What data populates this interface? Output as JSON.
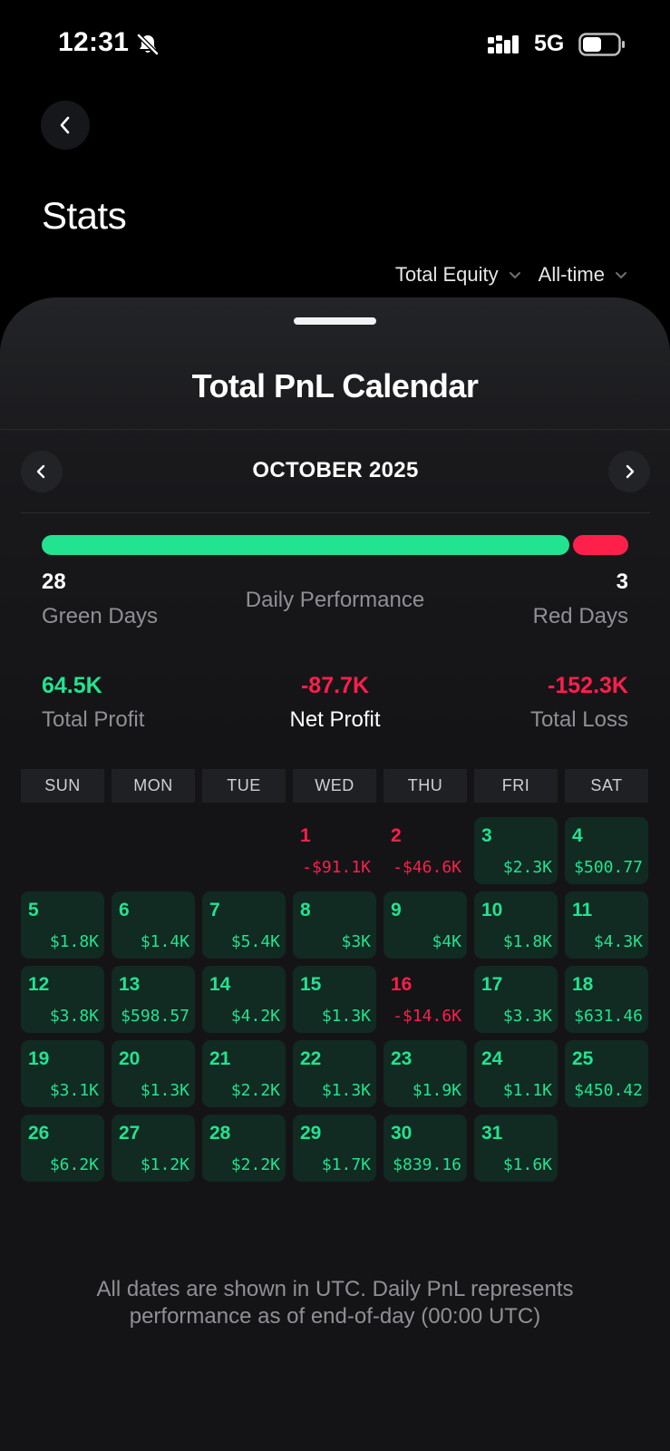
{
  "status_bar": {
    "time": "12:31",
    "network": "5G"
  },
  "page": {
    "title": "Stats"
  },
  "filters": {
    "equity": "Total Equity",
    "range": "All-time"
  },
  "sheet": {
    "title": "Total PnL Calendar"
  },
  "month": {
    "label": "OCTOBER 2025"
  },
  "performance": {
    "label": "Daily Performance",
    "green_count": "28",
    "green_label": "Green Days",
    "red_count": "3",
    "red_label": "Red Days",
    "green_fraction": 0.9032
  },
  "summary": {
    "total_profit_value": "64.5K",
    "total_profit_label": "Total Profit",
    "net_profit_value": "-87.7K",
    "net_profit_label": "Net Profit",
    "total_loss_value": "-152.3K",
    "total_loss_label": "Total Loss"
  },
  "weekdays": [
    "SUN",
    "MON",
    "TUE",
    "WED",
    "THU",
    "FRI",
    "SAT"
  ],
  "calendar": {
    "days": [
      {
        "day": "1",
        "value": "-$91.1K",
        "status": "neg"
      },
      {
        "day": "2",
        "value": "-$46.6K",
        "status": "neg"
      },
      {
        "day": "3",
        "value": "$2.3K",
        "status": "pos"
      },
      {
        "day": "4",
        "value": "$500.77",
        "status": "pos"
      },
      {
        "day": "5",
        "value": "$1.8K",
        "status": "pos"
      },
      {
        "day": "6",
        "value": "$1.4K",
        "status": "pos"
      },
      {
        "day": "7",
        "value": "$5.4K",
        "status": "pos"
      },
      {
        "day": "8",
        "value": "$3K",
        "status": "pos"
      },
      {
        "day": "9",
        "value": "$4K",
        "status": "pos"
      },
      {
        "day": "10",
        "value": "$1.8K",
        "status": "pos"
      },
      {
        "day": "11",
        "value": "$4.3K",
        "status": "pos"
      },
      {
        "day": "12",
        "value": "$3.8K",
        "status": "pos"
      },
      {
        "day": "13",
        "value": "$598.57",
        "status": "pos"
      },
      {
        "day": "14",
        "value": "$4.2K",
        "status": "pos"
      },
      {
        "day": "15",
        "value": "$1.3K",
        "status": "pos"
      },
      {
        "day": "16",
        "value": "-$14.6K",
        "status": "neg"
      },
      {
        "day": "17",
        "value": "$3.3K",
        "status": "pos"
      },
      {
        "day": "18",
        "value": "$631.46",
        "status": "pos"
      },
      {
        "day": "19",
        "value": "$3.1K",
        "status": "pos"
      },
      {
        "day": "20",
        "value": "$1.3K",
        "status": "pos"
      },
      {
        "day": "21",
        "value": "$2.2K",
        "status": "pos"
      },
      {
        "day": "22",
        "value": "$1.3K",
        "status": "pos"
      },
      {
        "day": "23",
        "value": "$1.9K",
        "status": "pos"
      },
      {
        "day": "24",
        "value": "$1.1K",
        "status": "pos"
      },
      {
        "day": "25",
        "value": "$450.42",
        "status": "pos"
      },
      {
        "day": "26",
        "value": "$6.2K",
        "status": "pos"
      },
      {
        "day": "27",
        "value": "$1.2K",
        "status": "pos"
      },
      {
        "day": "28",
        "value": "$2.2K",
        "status": "pos"
      },
      {
        "day": "29",
        "value": "$1.7K",
        "status": "pos"
      },
      {
        "day": "30",
        "value": "$839.16",
        "status": "pos"
      },
      {
        "day": "31",
        "value": "$1.6K",
        "status": "pos"
      }
    ]
  },
  "footnote": "All dates are shown in UTC. Daily PnL represents performance as of end-of-day (00:00 UTC)",
  "colors": {
    "green": "#22e38f",
    "red": "#ff1f4b",
    "background": "#000000",
    "sheet": "#141416"
  },
  "icons": [
    "bell-slash-icon",
    "signal-icon",
    "battery-icon",
    "chevron-left-icon",
    "chevron-down-icon",
    "chevron-right-icon"
  ]
}
